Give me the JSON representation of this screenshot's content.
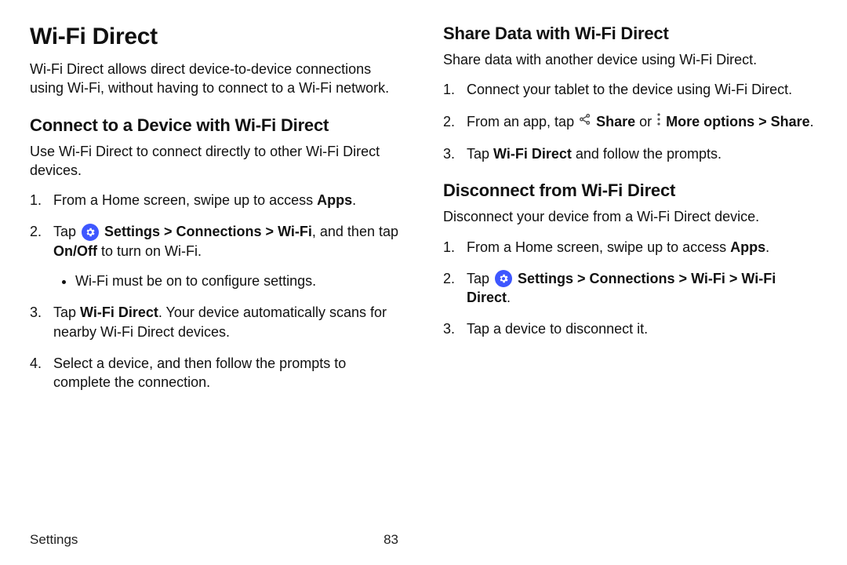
{
  "left": {
    "h1": "Wi-Fi Direct",
    "intro": "Wi-Fi Direct allows direct device-to-device connections using Wi-Fi, without having to connect to a Wi-Fi network.",
    "h2": "Connect to a Device with Wi-Fi Direct",
    "p2": "Use Wi-Fi Direct to connect directly to other Wi-Fi Direct devices.",
    "step1_a": "From a Home screen, swipe up to access ",
    "step1_b": "Apps",
    "step1_c": ".",
    "step2_a": "Tap ",
    "step2_b": " Settings > Connections > Wi-Fi",
    "step2_c": ", and then tap ",
    "step2_d": "On/Off",
    "step2_e": " to turn on Wi-Fi.",
    "step2_sub": "Wi-Fi must be on to configure settings.",
    "step3_a": "Tap ",
    "step3_b": "Wi-Fi Direct",
    "step3_c": ". Your device automatically scans for nearby Wi-Fi Direct devices.",
    "step4": "Select a device, and then follow the prompts to complete the connection."
  },
  "right": {
    "h2a": "Share Data with Wi-Fi Direct",
    "pa": "Share data with another device using Wi-Fi Direct.",
    "a1": "Connect your tablet to the device using Wi-Fi Direct.",
    "a2_a": "From an app, tap ",
    "a2_b": " Share",
    "a2_c": " or ",
    "a2_d": " More options > Share",
    "a2_e": ".",
    "a3_a": "Tap ",
    "a3_b": "Wi-Fi Direct",
    "a3_c": " and follow the prompts.",
    "h2b": "Disconnect from Wi-Fi Direct",
    "pb": "Disconnect your device from a Wi-Fi Direct device.",
    "b1_a": "From a Home screen, swipe up to access ",
    "b1_b": "Apps",
    "b1_c": ".",
    "b2_a": "Tap ",
    "b2_b": " Settings > Connections > Wi-Fi > Wi-Fi Direct",
    "b2_c": ".",
    "b3": "Tap a device to disconnect it."
  },
  "footer": {
    "section": "Settings",
    "page": "83"
  }
}
